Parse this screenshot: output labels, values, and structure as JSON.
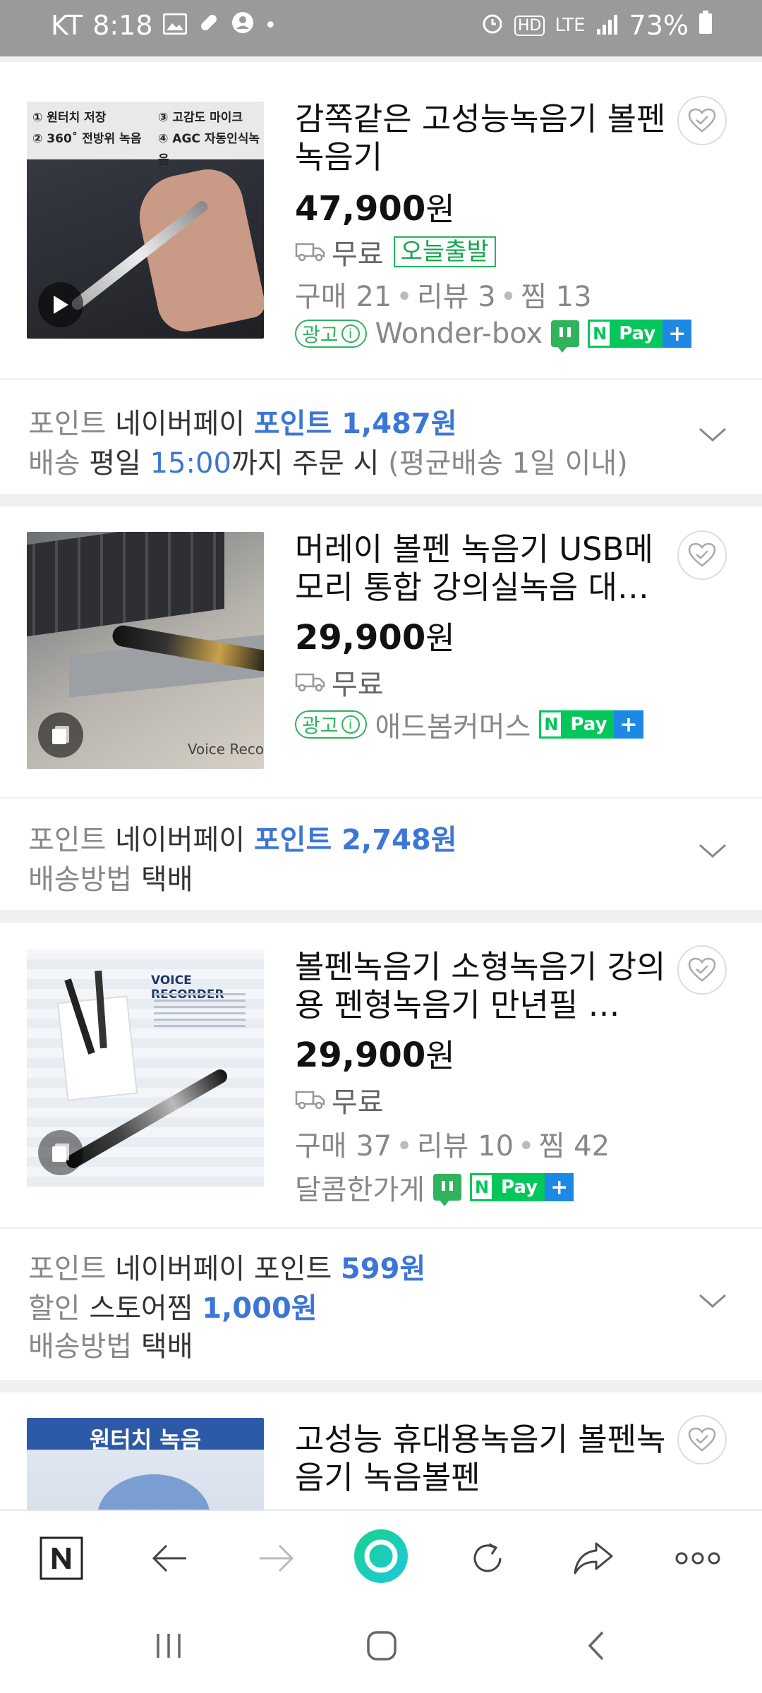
{
  "status_bar": {
    "carrier": "KT",
    "time": "8:18",
    "network": "LTE",
    "battery": "73%"
  },
  "products": [
    {
      "title": "감쪽같은 고성능녹음기 볼펜녹음기",
      "price": "47,900",
      "currency": "원",
      "shipping": "무료",
      "today_badge": "오늘출발",
      "meta": {
        "purchases": "구매 21",
        "reviews": "리뷰 3",
        "saves": "찜 13"
      },
      "ad_label": "광고",
      "seller": "Wonder-box",
      "thumb_text": {
        "f1": "① 원터치 저장",
        "f2": "② 360˚ 전방위 녹음",
        "f3": "③ 고감도 마이크",
        "f4": "④ AGC 자동인식녹음"
      },
      "info": {
        "l1_label": "포인트",
        "l1_text": "네이버페이",
        "l1_value": "포인트 1,487원",
        "l2_label": "배송",
        "l2_a": "평일",
        "l2_time": "15:00",
        "l2_b": "까지 주문 시",
        "l2_c": "(평균배송 1일 이내)"
      }
    },
    {
      "title": "머레이 볼펜 녹음기 USB메모리 통합 강의실녹음 대…",
      "price": "29,900",
      "currency": "원",
      "shipping": "무료",
      "ad_label": "광고",
      "seller": "애드봄커머스",
      "thumb_text": {
        "caption": "Voice Reco"
      },
      "info": {
        "l1_label": "포인트",
        "l1_text": "네이버페이",
        "l1_value": "포인트 2,748원",
        "l2_label": "배송방법",
        "l2_value": "택배"
      }
    },
    {
      "title": "볼펜녹음기 소형녹음기 강의용 펜형녹음기 만년필 …",
      "price": "29,900",
      "currency": "원",
      "shipping": "무료",
      "meta": {
        "purchases": "구매 37",
        "reviews": "리뷰 10",
        "saves": "찜 42"
      },
      "seller": "달콤한가게",
      "thumb_text": {
        "caption": "VOICE RECORDER"
      },
      "info": {
        "l1_label": "포인트",
        "l1_text": "네이버페이 포인트",
        "l1_value": "599원",
        "l2_label": "할인",
        "l2_text": "스토어찜",
        "l2_value": "1,000원",
        "l3_label": "배송방법",
        "l3_value": "택배"
      }
    },
    {
      "title": "고성능 휴대용녹음기 볼펜녹음기 녹음볼펜",
      "thumb_text": {
        "banner": "원터치 녹음"
      }
    }
  ],
  "pay_badge": {
    "n": "N",
    "pay": "Pay",
    "plus": "+"
  },
  "browser_nav": [
    "home",
    "back",
    "forward",
    "green-dot",
    "reload",
    "share",
    "more"
  ]
}
